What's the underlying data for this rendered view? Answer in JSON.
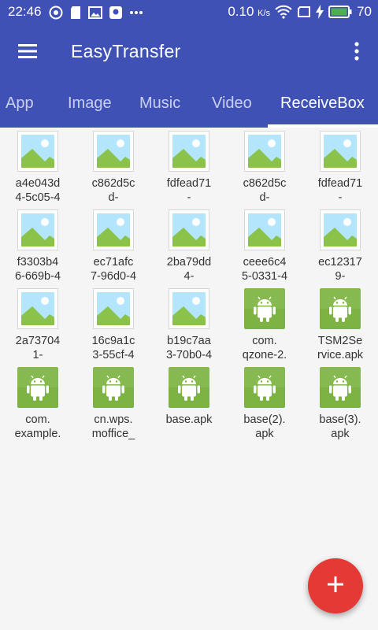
{
  "status_bar": {
    "time": "22:46",
    "speed": "0.10",
    "speed_unit": "K/s",
    "battery": "70",
    "left_icons": [
      "circle-target-icon",
      "sd-card-icon",
      "image-icon",
      "notification-icon",
      "more-dots-icon"
    ],
    "right_icons": [
      "wifi-icon",
      "screen-icon",
      "charging-icon",
      "battery-icon"
    ],
    "battery_color": "#4caf50"
  },
  "app_bar": {
    "title": "EasyTransfer",
    "menu_icon": "hamburger-menu-icon",
    "overflow_icon": "more-vertical-icon"
  },
  "tabs": [
    {
      "label": "App",
      "active": false
    },
    {
      "label": "Image",
      "active": false
    },
    {
      "label": "Music",
      "active": false
    },
    {
      "label": "Video",
      "active": false
    },
    {
      "label": "ReceiveBox",
      "active": true
    }
  ],
  "files": [
    {
      "type": "image",
      "lines": [
        "a4e043d",
        "4-5c05-4"
      ]
    },
    {
      "type": "image",
      "lines": [
        "c862d5c",
        "d-"
      ]
    },
    {
      "type": "image",
      "lines": [
        "fdfead71",
        "-"
      ]
    },
    {
      "type": "image",
      "lines": [
        "c862d5c",
        "d-"
      ]
    },
    {
      "type": "image",
      "lines": [
        "fdfead71",
        "-"
      ]
    },
    {
      "type": "image",
      "lines": [
        "f3303b4",
        "6-669b-4"
      ]
    },
    {
      "type": "image",
      "lines": [
        "ec71afc",
        "7-96d0-4"
      ]
    },
    {
      "type": "image",
      "lines": [
        "2ba79dd",
        "4-"
      ]
    },
    {
      "type": "image",
      "lines": [
        "ceee6c4",
        "5-0331-4"
      ]
    },
    {
      "type": "image",
      "lines": [
        "ec12317",
        "9-"
      ]
    },
    {
      "type": "image",
      "lines": [
        "2a73704",
        "1-"
      ]
    },
    {
      "type": "image",
      "lines": [
        "16c9a1c",
        "3-55cf-4"
      ]
    },
    {
      "type": "image",
      "lines": [
        "b19c7aa",
        "3-70b0-4"
      ]
    },
    {
      "type": "apk",
      "lines": [
        "com.",
        "qzone-2."
      ]
    },
    {
      "type": "apk",
      "lines": [
        "TSM2Se",
        "rvice.apk"
      ]
    },
    {
      "type": "apk",
      "lines": [
        "com.",
        "example."
      ]
    },
    {
      "type": "apk",
      "lines": [
        "cn.wps.",
        "moffice_"
      ]
    },
    {
      "type": "apk",
      "lines": [
        "base.apk"
      ]
    },
    {
      "type": "apk",
      "lines": [
        "base(2).",
        "apk"
      ]
    },
    {
      "type": "apk",
      "lines": [
        "base(3).",
        "apk"
      ]
    }
  ],
  "fab": {
    "icon": "plus-icon",
    "color": "#e53935"
  },
  "colors": {
    "primary": "#3f51b5",
    "apk_green": "#7cb342",
    "image_sky": "#b3e5fc",
    "image_grass": "#8bc34a"
  }
}
